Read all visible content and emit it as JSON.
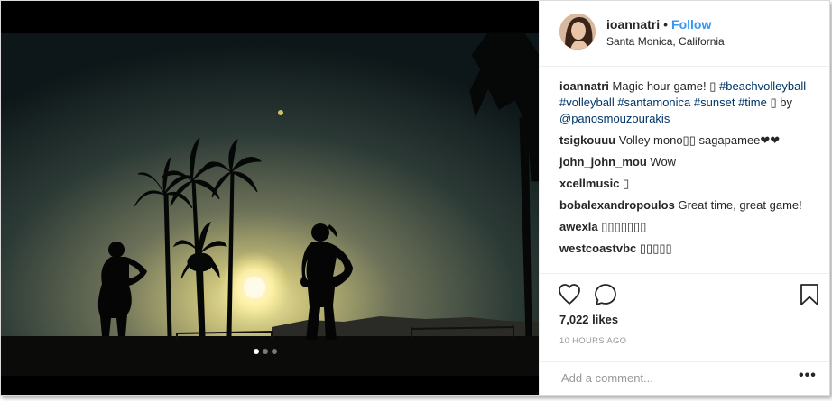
{
  "post": {
    "username": "ioannatri",
    "separator": "•",
    "follow_label": "Follow",
    "location": "Santa Monica, California",
    "likes": "7,022 likes",
    "time_ago": "10 HOURS AGO",
    "add_comment_placeholder": "Add a comment...",
    "more_label": "•••"
  },
  "caption": {
    "user": "ioannatri",
    "text": "Magic hour game! ▯",
    "tags": [
      "#beachvolleyball",
      "#volleyball",
      "#santamonica",
      "#sunset",
      "#time"
    ],
    "emoji": "▯",
    "by": "by",
    "credit": "@panosmouzourakis"
  },
  "comments": [
    {
      "user": "tsigkouuu",
      "text": "Volley mono▯▯ sagapamee❤❤"
    },
    {
      "user": "john_john_mou",
      "text": "Wow"
    },
    {
      "user": "xcellmusic",
      "text": "▯"
    },
    {
      "user": "bobalexandropoulos",
      "text": "Great time, great game!"
    },
    {
      "user": "awexla",
      "text": "▯▯▯▯▯▯▯"
    },
    {
      "user": "westcoastvbc",
      "text": "▯▯▯▯▯"
    }
  ],
  "carousel": {
    "count": 3,
    "active": 0
  },
  "icons": [
    "heart-icon",
    "comment-icon",
    "bookmark-icon"
  ],
  "colors": {
    "follow": "#3897f0",
    "hashtag": "#003569",
    "text": "#262626",
    "muted": "#999999"
  }
}
